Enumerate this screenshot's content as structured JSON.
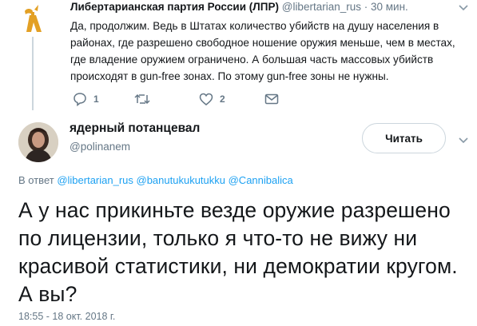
{
  "parent_tweet": {
    "author_name": "Либертарианская партия России (ЛПР)",
    "handle": "@libertarian_rus",
    "time": "· 30 мин.",
    "text": "Да, продолжим. Ведь в Штатах количество убийств на душу населения в районах, где разрешено свободное ношение оружия меньше, чем в местах, где владение оружием ограничено. А большая часть массовых убийств происходят в gun-free зонах. По этому gun-free зоны не нужны.",
    "reply_count": "1",
    "retweet_count": "",
    "like_count": "2",
    "icons": [
      "reply-icon",
      "retweet-icon",
      "like-icon",
      "message-icon",
      "chevron-down-icon"
    ]
  },
  "main_tweet": {
    "author_name": "ядерный потанцевал",
    "handle": "@polinanem",
    "follow_label": "Читать",
    "reply_prefix": "В ответ",
    "reply_handles": "@libertarian_rus @banutukukutukku @Cannibalica",
    "text": "А у нас прикиньте везде оружие разрешено по лицензии, только я что-то не вижу ни красивой статистики, ни демократии кругом. А вы?",
    "timestamp": "18:55 - 18 окт. 2018 г."
  },
  "colors": {
    "link": "#1da1f2",
    "secondary_text": "#657786",
    "primary_text": "#14171a",
    "border": "#ccd6dd",
    "logo": "#e3a024"
  }
}
